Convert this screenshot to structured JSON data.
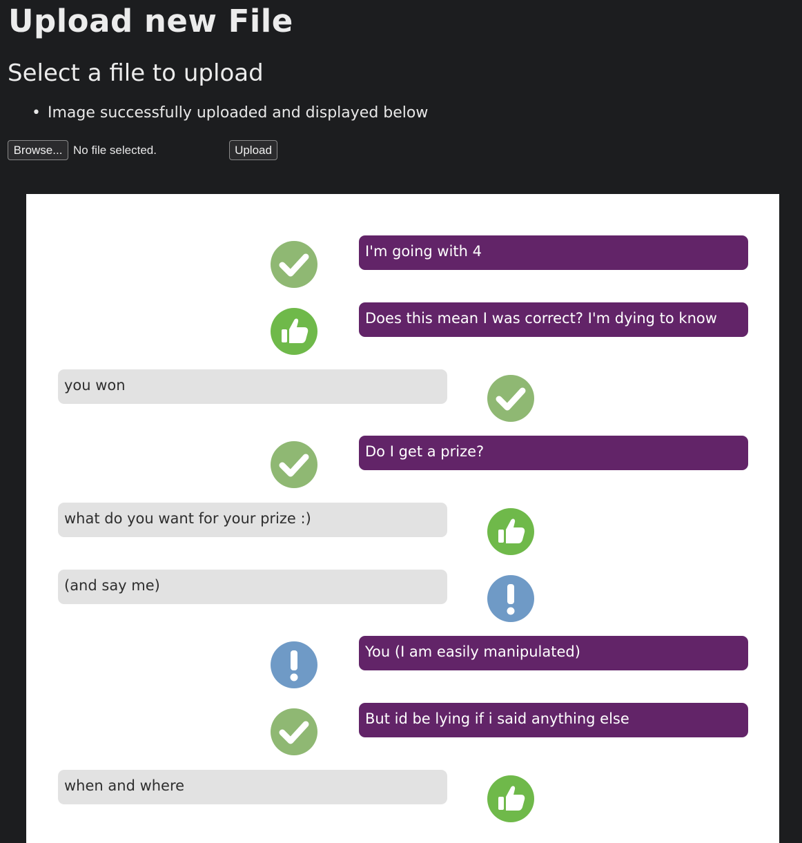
{
  "page": {
    "title": "Upload new File",
    "subtitle": "Select a file to upload",
    "flash_messages": [
      "Image successfully uploaded and displayed below"
    ]
  },
  "form": {
    "browse_label": "Browse...",
    "file_status": "No file selected.",
    "upload_label": "Upload"
  },
  "chat": {
    "messages": [
      {
        "side": "sent",
        "text": "I'm going with 4",
        "reaction": "check-icon"
      },
      {
        "side": "sent",
        "text": "Does this mean I was correct? I'm dying to know",
        "reaction": "thumbs-up-icon"
      },
      {
        "side": "received",
        "text": "you won",
        "reaction": "check-icon"
      },
      {
        "side": "sent",
        "text": "Do I get a prize?",
        "reaction": "check-icon"
      },
      {
        "side": "received",
        "text": "what do you want for your prize :)",
        "reaction": "thumbs-up-icon"
      },
      {
        "side": "received",
        "text": "(and say me)",
        "reaction": "exclamation-icon"
      },
      {
        "side": "sent",
        "text": "You (I am easily manipulated)",
        "reaction": "exclamation-icon"
      },
      {
        "side": "sent",
        "text": "But id be lying if i said anything else",
        "reaction": "check-icon"
      },
      {
        "side": "received",
        "text": "when and where",
        "reaction": "thumbs-up-icon"
      }
    ],
    "colors": {
      "sent_bubble": "#622468",
      "received_bubble": "#e2e2e2",
      "check": "#8fb873",
      "thumbs_up": "#6fb94a",
      "exclamation": "#6f9ac6"
    }
  }
}
